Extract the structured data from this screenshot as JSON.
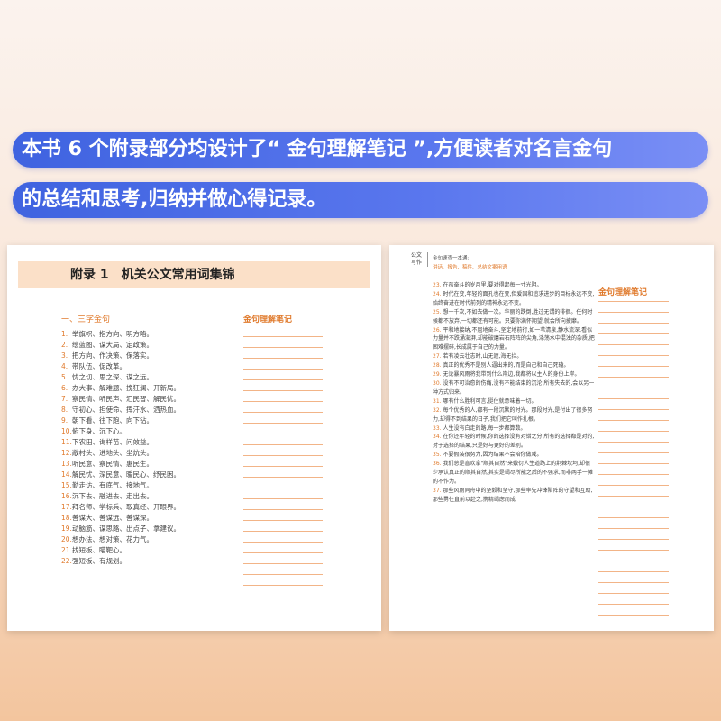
{
  "banner": {
    "line1": "本书 6 个附录部分均设计了“ 金句理解笔记 ”,方便读者对名言金句",
    "line2": "的总结和思考,归纳并做心得记录。"
  },
  "left": {
    "header": "附录 1　机关公文常用词集锦",
    "section": "一、三字金句",
    "note_title": "金句理解笔记",
    "items": [
      {
        "n": "1.",
        "t": "举旗帜、指方向、明方略。"
      },
      {
        "n": "2.",
        "t": "绘蓝图、谋大局、定政策。"
      },
      {
        "n": "3.",
        "t": "把方向、作决策、保落实。"
      },
      {
        "n": "4.",
        "t": "带队伍、促改革。"
      },
      {
        "n": "5.",
        "t": "忧之切、思之深、谋之远。"
      },
      {
        "n": "6.",
        "t": "办大事、解难题、挽狂澜、开新局。"
      },
      {
        "n": "7.",
        "t": "察民情、听民声、汇民智、解民忧。"
      },
      {
        "n": "8.",
        "t": "守初心、担使命、挥汗水、洒热血。"
      },
      {
        "n": "9.",
        "t": "朝下看、往下跑、向下钻。"
      },
      {
        "n": "10.",
        "t": "俯下身、沉下心。"
      },
      {
        "n": "11.",
        "t": "下农田、询样苗、问效益。"
      },
      {
        "n": "12.",
        "t": "敞村头、进地头、坐炕头。"
      },
      {
        "n": "13.",
        "t": "听民意、察民情、惠民生。"
      },
      {
        "n": "14.",
        "t": "解民忧、深民意、暖民心、纾民困。"
      },
      {
        "n": "15.",
        "t": "勤走访、有底气、接地气。"
      },
      {
        "n": "16.",
        "t": "沉下去、融进去、走出去。"
      },
      {
        "n": "17.",
        "t": "拜名师、学标兵、取真经、开眼界。"
      },
      {
        "n": "18.",
        "t": "善谋大、善谋远、善谋深。"
      },
      {
        "n": "19.",
        "t": "动脑筋、谋思路、出点子、拿建议。"
      },
      {
        "n": "20.",
        "t": "想办法、想对策、花力气。"
      },
      {
        "n": "21.",
        "t": "找短板、瞄靶心。"
      },
      {
        "n": "22.",
        "t": "强短板、有规划。"
      }
    ]
  },
  "right": {
    "logo": "公文写作",
    "header1": "金句速查一本通:",
    "header2": "讲话、报告、稿件、总结文案用语",
    "note_title": "金句理解笔记",
    "items": [
      {
        "n": "23.",
        "t": "在孩奋斗的岁月里,要对得起每一寸光阴。"
      },
      {
        "n": "24.",
        "t": "时代在变,年轻的面孔也在变,但爱国和追求进步的目标永远不变,始终奋进在时代前列的精神永远不变。"
      },
      {
        "n": "25.",
        "t": "想一千次,不如去做一次。华丽的跌倒,胜过无谓的徘徊。任何时候都不放弃,一切都还有可能。只要你满怀期望,就会所向披靡。"
      },
      {
        "n": "26.",
        "t": "平和地接纳,不屈地奋斗,坚定地前行,如一苇清泉,静水流深,看似力量并不跌涌澎湃,却能破磨岩石阵阵的尖角,涤荡水中混浊的杂质,把困难摆碎,长成属于自己的力量。"
      },
      {
        "n": "27.",
        "t": "若有凌云壮志时,山无遮,海无拦。"
      },
      {
        "n": "28.",
        "t": "真正的优秀不是别人逼出来的,而是自己和自己死磕。"
      },
      {
        "n": "29.",
        "t": "无论暴风雨将我带到什么岸边,我都将以主人的身份上岸。"
      },
      {
        "n": "30.",
        "t": "没有不可治愈的伤痛,没有不能结束的沉沦,所有失去的,会以另一种方式归来。"
      },
      {
        "n": "31.",
        "t": "哪有什么胜利可言,挺住就意味着一切。"
      },
      {
        "n": "32.",
        "t": "每个优秀的人,都有一段沉默的时光。那段时光,是付出了很多努力,却得不到结果的日子,我们把它叫作扎根。"
      },
      {
        "n": "33.",
        "t": "人生没有白走的路,每一步都算数。"
      },
      {
        "n": "34.",
        "t": "在你还年轻的时候,你的选择没有对错之分,所有的选择都是对的,对于选择的结果,只是好与更好的差别。"
      },
      {
        "n": "35.",
        "t": "不要假装很努力,因为结果不会陪你做戏。"
      },
      {
        "n": "36.",
        "t": "我们总是喜欢拿\"顺其自然\"来敷衍人生道路上的荆棘坎坷,却很少承认真正的顺其自然,其实是竭尽所能之后的不强求,而非两手一摊的不作为。"
      },
      {
        "n": "37.",
        "t": "那些风雨同舟中的坚毅和坚守,那些率先冲锋陷阵的守望和互助,那些勇往直前以赴之,携精竭虑而成"
      }
    ]
  }
}
